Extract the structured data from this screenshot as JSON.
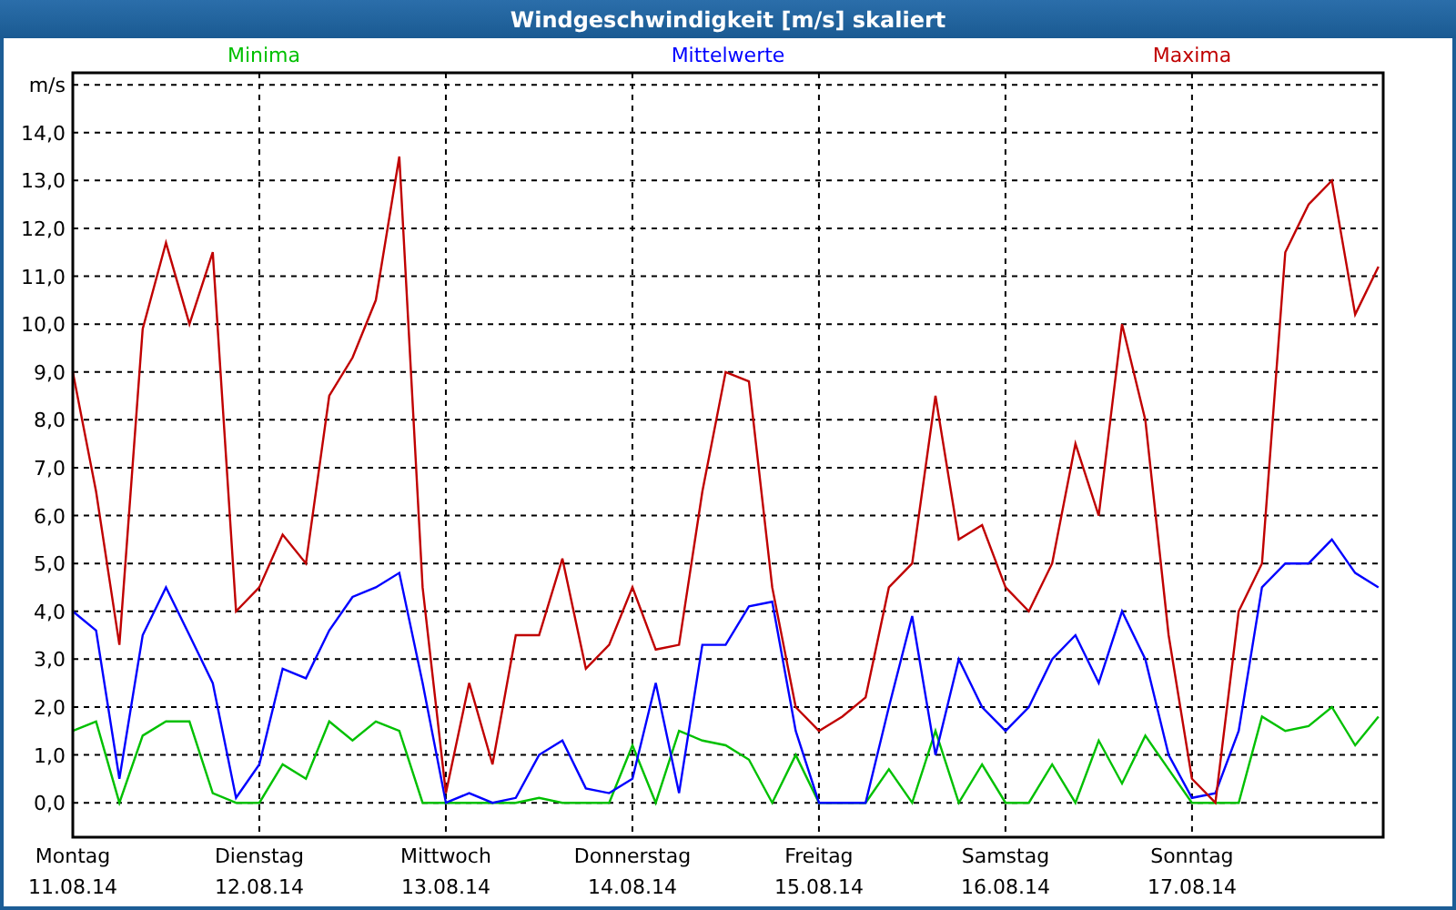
{
  "window": {
    "title": "Windgeschwindigkeit [m/s] skaliert"
  },
  "chart": {
    "chart_data": {
      "type": "line",
      "grid": true,
      "ylabel": "m/s",
      "ylim": [
        -0.72,
        15.25
      ],
      "yticks": [
        {
          "value": 0,
          "label": "0,0"
        },
        {
          "value": 1,
          "label": "1,0"
        },
        {
          "value": 2,
          "label": "2,0"
        },
        {
          "value": 3,
          "label": "3,0"
        },
        {
          "value": 4,
          "label": "4,0"
        },
        {
          "value": 5,
          "label": "5,0"
        },
        {
          "value": 6,
          "label": "6,0"
        },
        {
          "value": 7,
          "label": "7,0"
        },
        {
          "value": 8,
          "label": "8,0"
        },
        {
          "value": 9,
          "label": "9,0"
        },
        {
          "value": 10,
          "label": "10,0"
        },
        {
          "value": 11,
          "label": "11,0"
        },
        {
          "value": 12,
          "label": "12,0"
        },
        {
          "value": 13,
          "label": "13,0"
        },
        {
          "value": 14,
          "label": "14,0"
        }
      ],
      "categories": [
        "Montag 11.08.14",
        null,
        null,
        null,
        null,
        null,
        null,
        null,
        "Dienstag 12.08.14",
        null,
        null,
        null,
        null,
        null,
        null,
        null,
        "Mittwoch 13.08.14",
        null,
        null,
        null,
        null,
        null,
        null,
        null,
        "Donnerstag 14.08.14",
        null,
        null,
        null,
        null,
        null,
        null,
        null,
        "Freitag 15.08.14",
        null,
        null,
        null,
        null,
        null,
        null,
        null,
        "Samstag 16.08.14",
        null,
        null,
        null,
        null,
        null,
        null,
        null,
        "Sonntag 17.08.14",
        null,
        null,
        null,
        null,
        null,
        null,
        null,
        null
      ],
      "series": [
        {
          "name": "Minima",
          "color": "#00c000",
          "values": [
            1.5,
            1.7,
            0.0,
            1.4,
            1.7,
            1.7,
            0.2,
            0.0,
            0.0,
            0.8,
            0.5,
            1.7,
            1.3,
            1.7,
            1.5,
            0.0,
            0.0,
            0.0,
            0.0,
            0.0,
            0.1,
            0.0,
            0.0,
            0.0,
            1.2,
            0.0,
            1.5,
            1.3,
            1.2,
            0.9,
            0.0,
            1.0,
            0.0,
            0.0,
            0.0,
            0.7,
            0.0,
            1.5,
            0.0,
            0.8,
            0.0,
            0.0,
            0.8,
            0.0,
            1.3,
            0.4,
            1.4,
            0.7,
            0.0,
            0.0,
            0.0,
            1.8,
            1.5,
            1.6,
            2.0,
            1.2,
            1.8
          ]
        },
        {
          "name": "Mittelwerte",
          "color": "#0000ff",
          "values": [
            4.0,
            3.6,
            0.5,
            3.5,
            4.5,
            3.5,
            2.5,
            0.1,
            0.8,
            2.8,
            2.6,
            3.6,
            4.3,
            4.5,
            4.8,
            2.5,
            0.0,
            0.2,
            0.0,
            0.1,
            1.0,
            1.3,
            0.3,
            0.2,
            0.5,
            2.5,
            0.2,
            3.3,
            3.3,
            4.1,
            4.2,
            1.5,
            0.0,
            0.0,
            0.0,
            2.0,
            3.9,
            1.0,
            3.0,
            2.0,
            1.5,
            2.0,
            3.0,
            3.5,
            2.5,
            4.0,
            3.0,
            1.0,
            0.1,
            0.2,
            1.5,
            4.5,
            5.0,
            5.0,
            5.5,
            4.8,
            4.5
          ]
        },
        {
          "name": "Maxima",
          "color": "#c00000",
          "values": [
            9.0,
            6.5,
            3.3,
            9.9,
            11.7,
            10.0,
            11.5,
            4.0,
            4.5,
            5.6,
            5.0,
            8.5,
            9.3,
            10.5,
            13.5,
            4.5,
            0.2,
            2.5,
            0.8,
            3.5,
            3.5,
            5.1,
            2.8,
            3.3,
            4.5,
            3.2,
            3.3,
            6.5,
            9.0,
            8.8,
            4.5,
            2.0,
            1.5,
            1.8,
            2.2,
            4.5,
            5.0,
            8.5,
            5.5,
            5.8,
            4.5,
            4.0,
            5.0,
            7.5,
            6.0,
            10.0,
            8.0,
            3.5,
            0.5,
            0.0,
            4.0,
            5.0,
            11.5,
            12.5,
            13.0,
            10.2,
            11.2
          ]
        }
      ]
    }
  }
}
